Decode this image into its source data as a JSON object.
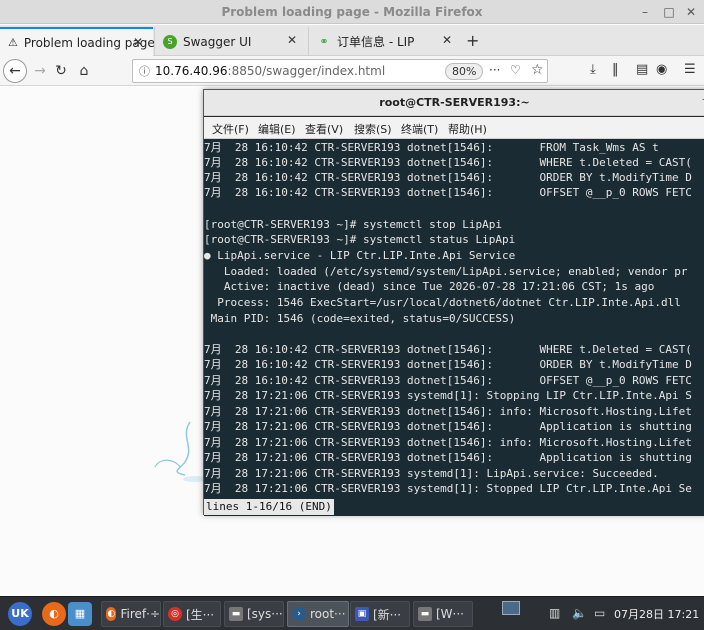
{
  "firefox": {
    "window_title": "Problem loading page - Mozilla Firefox",
    "tabs": [
      {
        "label": "Problem loading page",
        "icon": "warning-icon"
      },
      {
        "label": "Swagger UI",
        "icon": "swagger-icon"
      },
      {
        "label": "订单信息 - LIP",
        "icon": "link-icon"
      }
    ],
    "url": {
      "host": "10.76.40.96",
      "rest": ":8850/swagger/index.html"
    },
    "zoom": "80%"
  },
  "terminal": {
    "title": "root@CTR-SERVER193:~",
    "menu": [
      "文件(F)",
      "编辑(E)",
      "查看(V)",
      "搜索(S)",
      "终端(T)",
      "帮助(H)"
    ],
    "lines": [
      "7月  28 16:10:42 CTR-SERVER193 dotnet[1546]:       FROM Task_Wms AS t",
      "7月  28 16:10:42 CTR-SERVER193 dotnet[1546]:       WHERE t.Deleted = CAST(",
      "7月  28 16:10:42 CTR-SERVER193 dotnet[1546]:       ORDER BY t.ModifyTime D",
      "7月  28 16:10:42 CTR-SERVER193 dotnet[1546]:       OFFSET @__p_0 ROWS FETC",
      "",
      "[root@CTR-SERVER193 ~]# systemctl stop LipApi",
      "[root@CTR-SERVER193 ~]# systemctl status LipApi",
      "● LipApi.service - LIP Ctr.LIP.Inte.Api Service",
      "   Loaded: loaded (/etc/systemd/system/LipApi.service; enabled; vendor pr",
      "   Active: inactive (dead) since Tue 2026-07-28 17:21:06 CST; 1s ago",
      "  Process: 1546 ExecStart=/usr/local/dotnet6/dotnet Ctr.LIP.Inte.Api.dll",
      " Main PID: 1546 (code=exited, status=0/SUCCESS)",
      "",
      "7月  28 16:10:42 CTR-SERVER193 dotnet[1546]:       WHERE t.Deleted = CAST(",
      "7月  28 16:10:42 CTR-SERVER193 dotnet[1546]:       ORDER BY t.ModifyTime D",
      "7月  28 16:10:42 CTR-SERVER193 dotnet[1546]:       OFFSET @__p_0 ROWS FETC",
      "7月  28 17:21:06 CTR-SERVER193 systemd[1]: Stopping LIP Ctr.LIP.Inte.Api S",
      "7月  28 17:21:06 CTR-SERVER193 dotnet[1546]: info: Microsoft.Hosting.Lifet",
      "7月  28 17:21:06 CTR-SERVER193 dotnet[1546]:       Application is shutting",
      "7月  28 17:21:06 CTR-SERVER193 dotnet[1546]: info: Microsoft.Hosting.Lifet",
      "7月  28 17:21:06 CTR-SERVER193 dotnet[1546]:       Application is shutting",
      "7月  28 17:21:06 CTR-SERVER193 systemd[1]: LipApi.service: Succeeded.",
      "7月  28 17:21:06 CTR-SERVER193 systemd[1]: Stopped LIP Ctr.LIP.Inte.Api Se"
    ],
    "pager_status": "lines 1-16/16 (END)"
  },
  "taskbar": {
    "items": [
      {
        "label": "Firef·÷",
        "icon": "firefox-icon"
      },
      {
        "label": "[生···",
        "icon": "chrome-icon"
      },
      {
        "label": "[sys···",
        "icon": "folder-icon"
      },
      {
        "label": "root···",
        "icon": "terminal-icon"
      },
      {
        "label": "[新···",
        "icon": "app-icon"
      },
      {
        "label": "[W···",
        "icon": "folder-icon"
      }
    ],
    "clock": "07月28日 17:21"
  }
}
